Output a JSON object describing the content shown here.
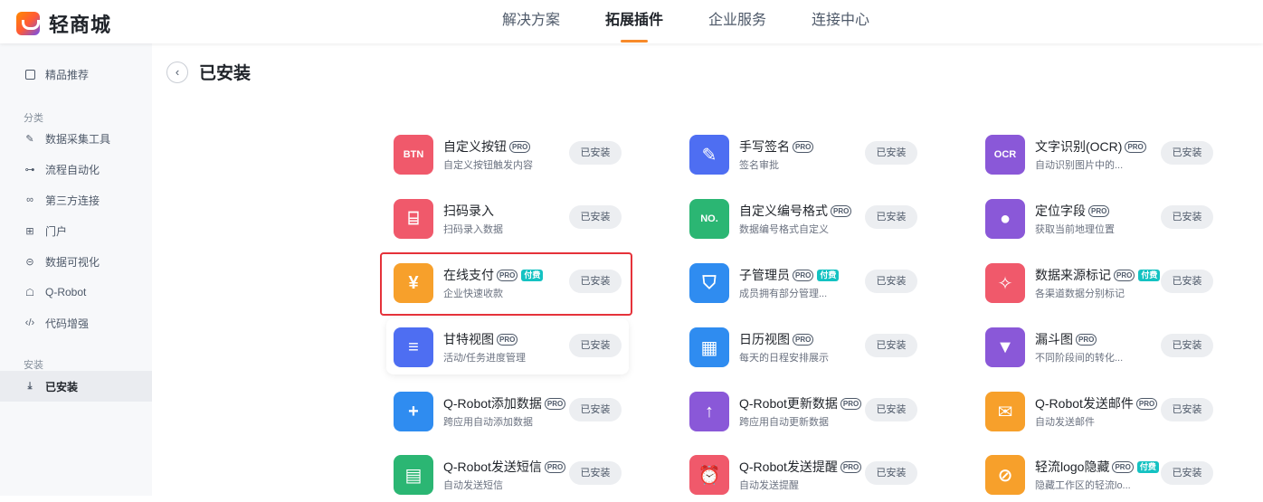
{
  "header": {
    "brand": "轻商城",
    "nav": [
      {
        "label": "解决方案",
        "active": false
      },
      {
        "label": "拓展插件",
        "active": true
      },
      {
        "label": "企业服务",
        "active": false
      },
      {
        "label": "连接中心",
        "active": false
      }
    ],
    "accent_color": "#f78a2a"
  },
  "sidebar": {
    "featured": {
      "label": "精品推荐",
      "icon": "featured-icon"
    },
    "category_title": "分类",
    "categories": [
      {
        "label": "数据采集工具",
        "icon": "form-edit-icon"
      },
      {
        "label": "流程自动化",
        "icon": "flow-icon"
      },
      {
        "label": "第三方连接",
        "icon": "link-icon"
      },
      {
        "label": "门户",
        "icon": "portal-icon"
      },
      {
        "label": "数据可视化",
        "icon": "chart-icon"
      },
      {
        "label": "Q-Robot",
        "icon": "robot-icon"
      },
      {
        "label": "代码增强",
        "icon": "code-icon"
      }
    ],
    "install_title": "安装",
    "installed": {
      "label": "已安装",
      "icon": "download-icon",
      "active": true
    }
  },
  "main": {
    "title": "已安装",
    "pro_label": "PRO",
    "paid_label": "付费",
    "plugins": [
      {
        "name": "自定义按钮",
        "desc": "自定义按钮触发内容",
        "pro": true,
        "paid": false,
        "icon": "btn-icon",
        "glyph": "BTN",
        "color": "#f0596b",
        "button": "已安装"
      },
      {
        "name": "手写签名",
        "desc": "签名审批",
        "pro": true,
        "paid": false,
        "icon": "pen-icon",
        "glyph": "✎",
        "color": "#4e6ef2",
        "button": "已安装"
      },
      {
        "name": "文字识别(OCR)",
        "desc": "自动识别图片中的...",
        "pro": true,
        "paid": false,
        "icon": "ocr-icon",
        "glyph": "OCR",
        "color": "#8a58d8",
        "button": "已安装"
      },
      {
        "name": "扫码录入",
        "desc": "扫码录入数据",
        "pro": false,
        "paid": false,
        "icon": "scan-icon",
        "glyph": "⌸",
        "color": "#f0596b",
        "button": "已安装"
      },
      {
        "name": "自定义编号格式",
        "desc": "数据编号格式自定义",
        "pro": true,
        "paid": false,
        "icon": "number-icon",
        "glyph": "NO.",
        "color": "#2bb673",
        "button": "已安装"
      },
      {
        "name": "定位字段",
        "desc": "获取当前地理位置",
        "pro": true,
        "paid": false,
        "icon": "location-icon",
        "glyph": "●",
        "color": "#8a58d8",
        "button": "已安装"
      },
      {
        "name": "在线支付",
        "desc": "企业快速收款",
        "pro": true,
        "paid": true,
        "icon": "yen-icon",
        "glyph": "¥",
        "color": "#f7a02b",
        "button": "已安装"
      },
      {
        "name": "子管理员",
        "desc": "成员拥有部分管理...",
        "pro": true,
        "paid": true,
        "icon": "shield-icon",
        "glyph": "⛉",
        "color": "#2f8cf0",
        "button": "已安装"
      },
      {
        "name": "数据来源标记",
        "desc": "各渠道数据分别标记",
        "pro": true,
        "paid": true,
        "icon": "pin-icon",
        "glyph": "✧",
        "color": "#f0596b",
        "button": "已安装"
      },
      {
        "name": "甘特视图",
        "desc": "活动/任务进度管理",
        "pro": true,
        "paid": false,
        "icon": "gantt-icon",
        "glyph": "≡",
        "color": "#4e6ef2",
        "button": "已安装"
      },
      {
        "name": "日历视图",
        "desc": "每天的日程安排展示",
        "pro": true,
        "paid": false,
        "icon": "calendar-icon",
        "glyph": "▦",
        "color": "#2f8cf0",
        "button": "已安装"
      },
      {
        "name": "漏斗图",
        "desc": "不同阶段间的转化...",
        "pro": true,
        "paid": false,
        "icon": "funnel-icon",
        "glyph": "▼",
        "color": "#8a58d8",
        "button": "已安装"
      },
      {
        "name": "Q-Robot添加数据",
        "desc": "跨应用自动添加数据",
        "pro": true,
        "paid": false,
        "icon": "add-data-icon",
        "glyph": "+",
        "color": "#2f8cf0",
        "button": "已安装"
      },
      {
        "name": "Q-Robot更新数据",
        "desc": "跨应用自动更新数据",
        "pro": true,
        "paid": false,
        "icon": "update-data-icon",
        "glyph": "↑",
        "color": "#8a58d8",
        "button": "已安装"
      },
      {
        "name": "Q-Robot发送邮件",
        "desc": "自动发送邮件",
        "pro": true,
        "paid": false,
        "icon": "mail-icon",
        "glyph": "✉",
        "color": "#f7a02b",
        "button": "已安装"
      },
      {
        "name": "Q-Robot发送短信",
        "desc": "自动发送短信",
        "pro": true,
        "paid": false,
        "icon": "sms-icon",
        "glyph": "▤",
        "color": "#2bb673",
        "button": "已安装"
      },
      {
        "name": "Q-Robot发送提醒",
        "desc": "自动发送提醒",
        "pro": true,
        "paid": false,
        "icon": "alarm-icon",
        "glyph": "⏰",
        "color": "#f0596b",
        "button": "已安装"
      },
      {
        "name": "轻流logo隐藏",
        "desc": "隐藏工作区的轻流lo...",
        "pro": true,
        "paid": true,
        "icon": "hide-logo-icon",
        "glyph": "⊘",
        "color": "#f7a02b",
        "button": "已安装"
      }
    ],
    "highlight_color": "#e5323a"
  }
}
